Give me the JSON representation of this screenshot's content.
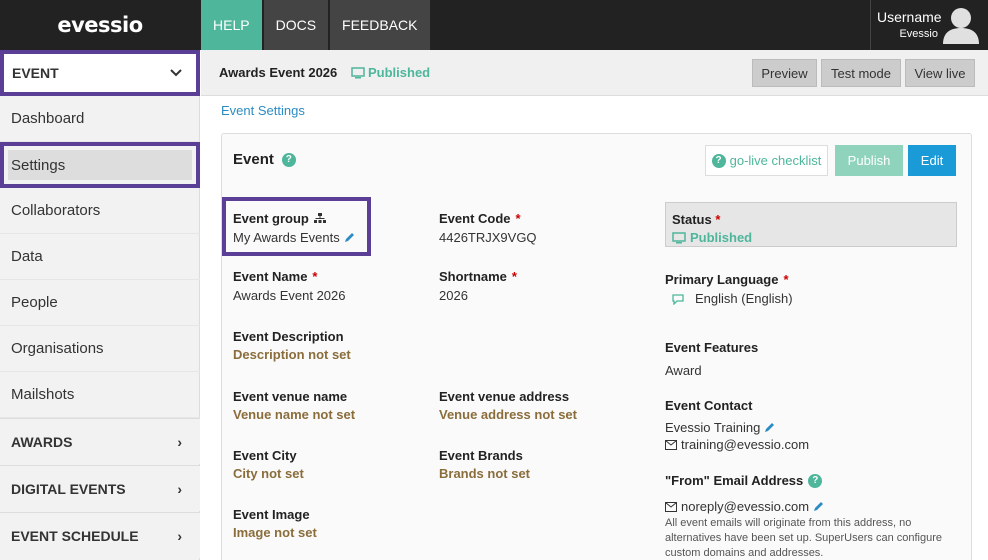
{
  "topbar": {
    "logo": "evessio",
    "tabs": [
      {
        "label": "HELP",
        "active": true
      },
      {
        "label": "DOCS",
        "active": false
      },
      {
        "label": "FEEDBACK",
        "active": false
      }
    ],
    "user": {
      "name": "Username",
      "org": "Evessio",
      "icon": "user-avatar-icon"
    }
  },
  "sidebar": {
    "header": "EVENT",
    "items": [
      "Dashboard",
      "Settings",
      "Collaborators",
      "Data",
      "People",
      "Organisations",
      "Mailshots"
    ],
    "selected": "Settings",
    "sections": [
      "AWARDS",
      "DIGITAL EVENTS",
      "EVENT SCHEDULE"
    ]
  },
  "header": {
    "title": "Awards Event 2026",
    "status": "Published",
    "buttons": [
      "Preview",
      "Test mode",
      "View live"
    ]
  },
  "breadcrumb": "Event Settings",
  "panel": {
    "title": "Event",
    "checklist_label": "go-live checklist",
    "publish_label": "Publish",
    "edit_label": "Edit",
    "fields": {
      "event_group": {
        "label": "Event group",
        "value": "My Awards Events"
      },
      "event_code": {
        "label": "Event Code",
        "value": "4426TRJX9VGQ"
      },
      "event_name": {
        "label": "Event Name",
        "value": "Awards Event 2026"
      },
      "shortname": {
        "label": "Shortname",
        "value": "2026"
      },
      "description": {
        "label": "Event Description",
        "value": "Description not set"
      },
      "venue_name": {
        "label": "Event venue name",
        "value": "Venue name not set"
      },
      "venue_address": {
        "label": "Event venue address",
        "value": "Venue address not set"
      },
      "city": {
        "label": "Event City",
        "value": "City not set"
      },
      "brands": {
        "label": "Event Brands",
        "value": "Brands not set"
      },
      "image": {
        "label": "Event Image",
        "value": "Image not set"
      },
      "status": {
        "label": "Status",
        "value": "Published"
      },
      "language": {
        "label": "Primary Language",
        "value": "English (English)"
      },
      "features": {
        "label": "Event Features",
        "value": "Award"
      },
      "contact": {
        "label": "Event Contact",
        "name": "Evessio Training",
        "email": "training@evessio.com"
      },
      "from_email": {
        "label": "\"From\" Email Address",
        "value": "noreply@evessio.com",
        "note": "All event emails will originate from this address, no alternatives have been set up. SuperUsers can configure custom domains and addresses."
      }
    },
    "required_marker": "*"
  },
  "colors": {
    "accent": "#4eb69b",
    "primary": "#1b9ad8",
    "highlight": "#5b3f97",
    "unset": "#8a6d3b"
  }
}
